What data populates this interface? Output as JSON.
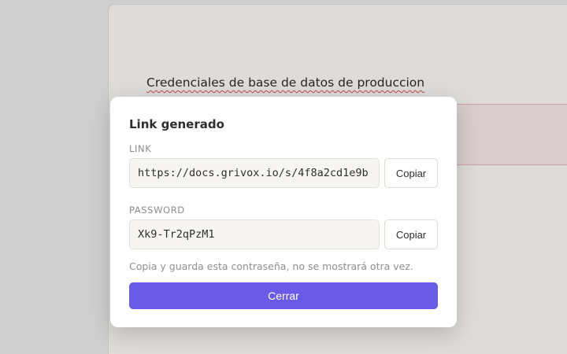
{
  "document": {
    "title": "Credenciales de base de datos de produccion"
  },
  "modal": {
    "title": "Link generado",
    "link": {
      "label": "LINK",
      "value": "https://docs.grivox.io/s/4f8a2cd1e9b",
      "copy_label": "Copiar"
    },
    "password": {
      "label": "PASSWORD",
      "value": "Xk9-Tr2qPzM1",
      "copy_label": "Copiar"
    },
    "hint": "Copia y guarda esta contraseña, no se mostrará otra vez.",
    "close_label": "Cerrar"
  },
  "colors": {
    "accent": "#6a5ae8",
    "alert_background": "#f6e9e9"
  }
}
